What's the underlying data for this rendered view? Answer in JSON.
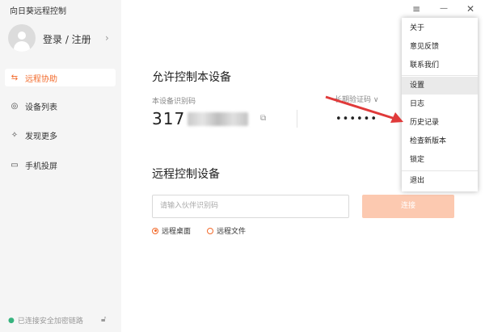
{
  "app": {
    "title": "向日葵远程控制"
  },
  "user": {
    "login_label": "登录 / 注册",
    "chevron": "›"
  },
  "sidebar": {
    "items": [
      {
        "label": "远程协助",
        "icon": "remote-assist-icon",
        "active": true
      },
      {
        "label": "设备列表",
        "icon": "device-list-icon"
      },
      {
        "label": "发现更多",
        "icon": "discover-icon"
      },
      {
        "label": "手机投屏",
        "icon": "screen-cast-icon"
      }
    ],
    "status": "已连接安全加密链路"
  },
  "window": {
    "menu_icon": "≡",
    "minimize_icon": "—",
    "close_icon": "✕"
  },
  "allow": {
    "title": "允许控制本设备",
    "id_label": "本设备识别码",
    "id_value": "317",
    "pw_label": "长期验证码 ∨",
    "pw_value": "••••••"
  },
  "control": {
    "title": "远程控制设备",
    "input_placeholder": "请输入伙伴识别码",
    "connect_label": "连接",
    "options": [
      "远程桌面",
      "远程文件"
    ]
  },
  "menu": {
    "items": [
      "关于",
      "意见反馈",
      "联系我们",
      "设置",
      "日志",
      "历史记录",
      "检查新版本",
      "锁定",
      "退出"
    ]
  },
  "colors": {
    "accent": "#f26a2b",
    "sidebar_bg": "#f5f5f5",
    "annotation_arrow": "#e03a3a"
  }
}
